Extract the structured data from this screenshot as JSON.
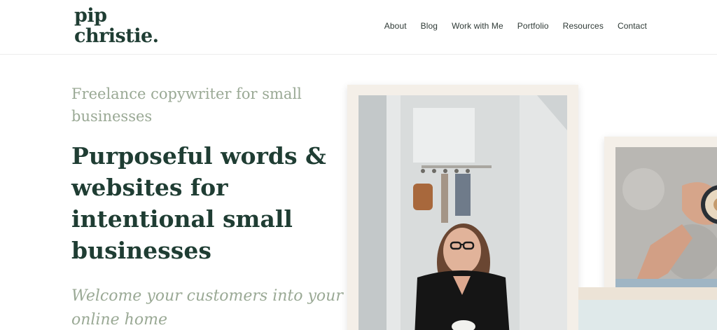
{
  "logo": {
    "line1": "pip",
    "line2": "christie."
  },
  "nav": {
    "items": [
      {
        "label": "About"
      },
      {
        "label": "Blog"
      },
      {
        "label": "Work with Me"
      },
      {
        "label": "Portfolio"
      },
      {
        "label": "Resources"
      },
      {
        "label": "Contact"
      }
    ]
  },
  "hero": {
    "eyebrow": "Freelance copywriter for small businesses",
    "headline": "Purposeful words & websites for intentional small businesses",
    "tagline": "Welcome your customers into your online home"
  },
  "colors": {
    "brand_green": "#1f3d33",
    "sage": "#9aa995",
    "frame_cream": "#f4efe8"
  }
}
